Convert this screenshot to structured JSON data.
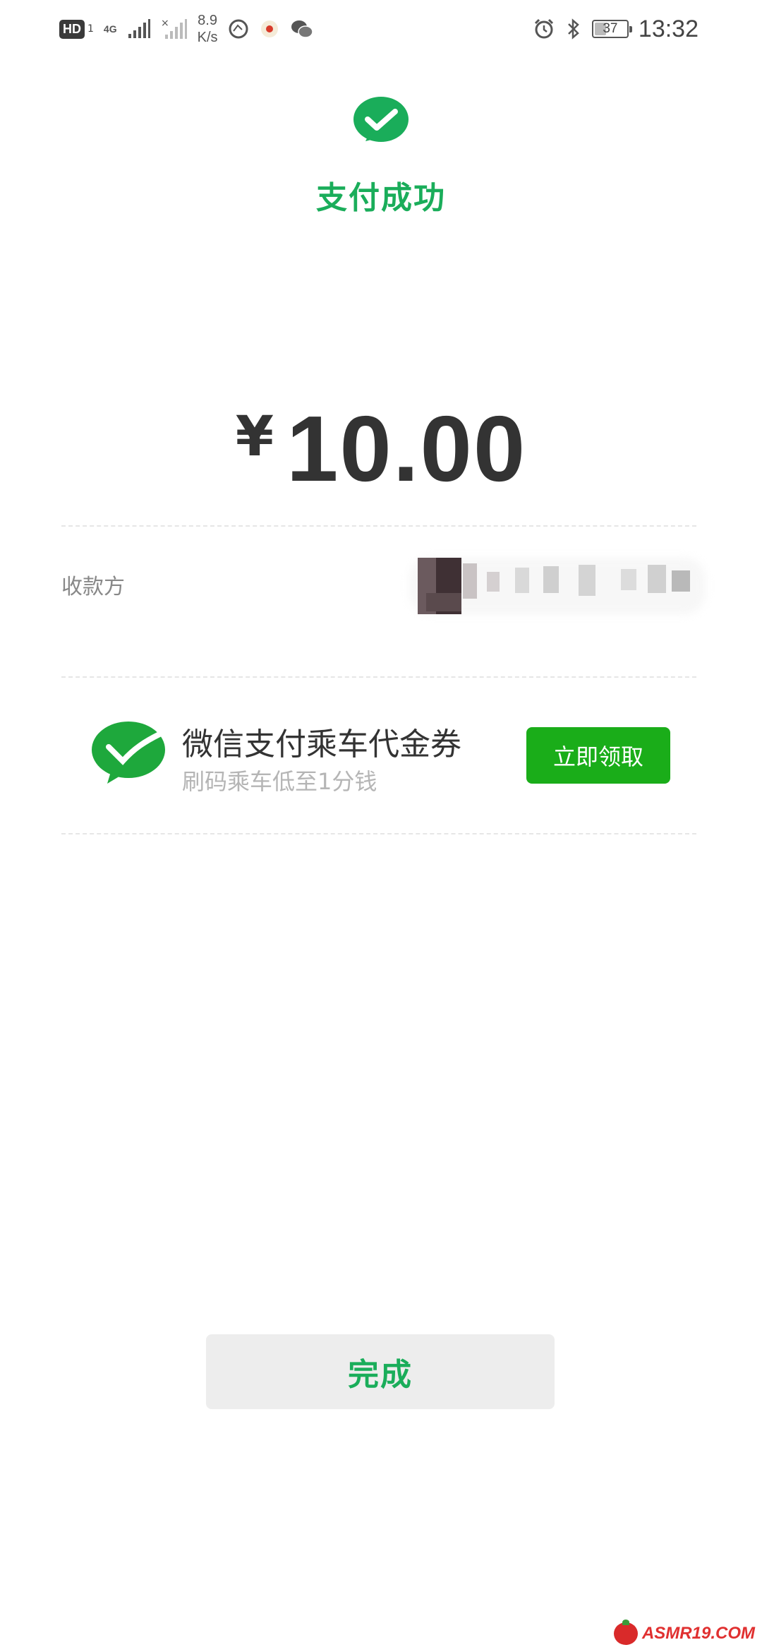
{
  "status_bar": {
    "hd_label": "HD",
    "sim_number": "1",
    "network_type": "4G",
    "net_speed_value": "8.9",
    "net_speed_unit": "K/s",
    "battery_level": "37",
    "time": "13:32"
  },
  "header": {
    "title": "支付成功"
  },
  "payment": {
    "currency_symbol": "¥",
    "amount": "10.00",
    "payee_label": "收款方"
  },
  "coupon": {
    "title": "微信支付乘车代金券",
    "subtitle": "刷码乘车低至1分钱",
    "claim_label": "立即领取"
  },
  "footer": {
    "done_label": "完成"
  },
  "watermark": {
    "text": "ASMR19.COM"
  },
  "colors": {
    "brand_green": "#1aad5a",
    "button_green": "#1aad19",
    "done_bg": "#ededed"
  }
}
